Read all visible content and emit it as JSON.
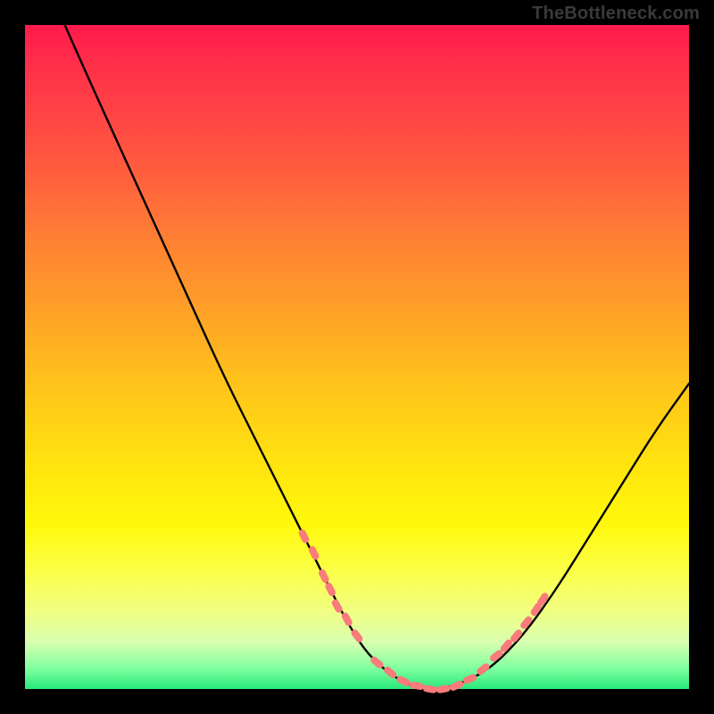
{
  "watermark": "TheBottleneck.com",
  "palette": {
    "background": "#000000",
    "gradient_stops": [
      "#ff1a4b",
      "#ff2f4a",
      "#ff5740",
      "#ff7f34",
      "#ffa426",
      "#ffc61a",
      "#ffe30f",
      "#fff80a",
      "#fbff45",
      "#f2ff80",
      "#d8ffb0",
      "#7cff9e",
      "#28e87a"
    ],
    "curve_color": "#000000",
    "marker_color": "#f97b7b"
  },
  "chart_data": {
    "type": "line",
    "title": "",
    "xlabel": "",
    "ylabel": "",
    "xlim": [
      0,
      100
    ],
    "ylim": [
      0,
      100
    ],
    "grid": false,
    "series": [
      {
        "name": "bottleneck-curve",
        "x": [
          6,
          10,
          15,
          20,
          25,
          30,
          35,
          40,
          45,
          48,
          51,
          54,
          57,
          60,
          63,
          66,
          70,
          75,
          80,
          85,
          90,
          95,
          100
        ],
        "y": [
          100,
          91,
          80,
          69,
          58,
          47,
          37,
          27,
          17,
          11,
          6,
          3,
          1,
          0,
          0,
          1,
          3,
          8,
          15,
          23,
          31,
          39,
          46
        ]
      }
    ],
    "markers": {
      "name": "highlight-points",
      "x": [
        42,
        43.5,
        45,
        46,
        47,
        48.5,
        50,
        53,
        55,
        57,
        59,
        61,
        63,
        65,
        67,
        69,
        71,
        72.5,
        74,
        75.5,
        77,
        78
      ],
      "y": [
        23,
        20.5,
        17,
        15,
        12.5,
        10.5,
        8,
        4,
        2.5,
        1.2,
        0.5,
        0,
        0,
        0.5,
        1.5,
        3,
        5,
        6.5,
        8,
        10,
        12,
        13.5
      ]
    }
  }
}
